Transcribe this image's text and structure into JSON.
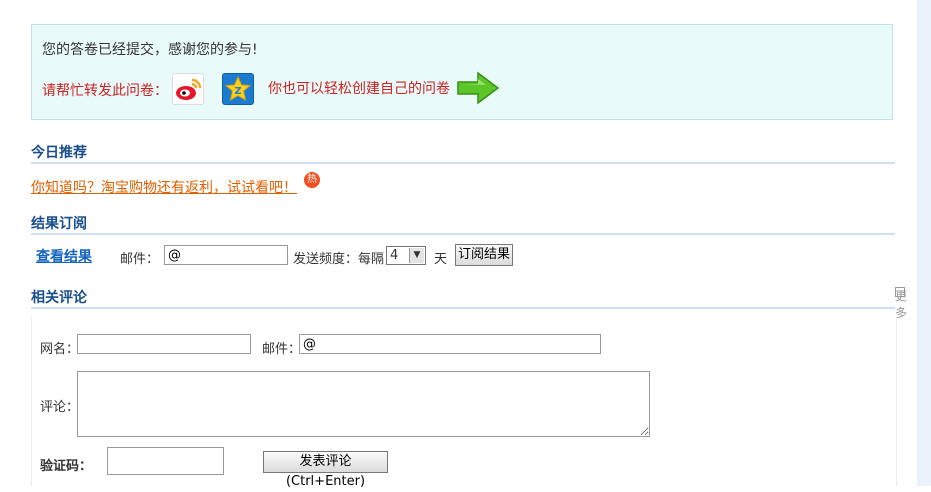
{
  "notice": {
    "thanks": "您的答卷已经提交，感谢您的参与!",
    "share_label": "请帮忙转发此问卷：",
    "create_link": "你也可以轻松创建自己的问卷"
  },
  "today": {
    "title": "今日推荐",
    "promo_text": "你知道吗？淘宝购物还有返利，试试看吧！",
    "hot_badge": "热"
  },
  "subscribe": {
    "title": "结果订阅",
    "view_results": "查看结果",
    "email_label": "邮件：",
    "email_value": "@",
    "freq_label": "发送频度：每隔",
    "freq_value": "4",
    "day_label": "天",
    "button": "订阅结果"
  },
  "comments": {
    "title": "相关评论",
    "more": "更多",
    "name_label": "网名：",
    "name_value": "",
    "email_label": "邮件：",
    "email_value": "@",
    "comment_label": "评论：",
    "captcha_label": "验证码：",
    "captcha_value": "",
    "submit": "发表评论(Ctrl+Enter)"
  },
  "colors": {
    "accent_red": "#cc2222",
    "link_blue": "#1565c0",
    "section_title": "#1a4f8a",
    "promo_orange": "#e06000",
    "notice_bg": "#e8fafa"
  }
}
